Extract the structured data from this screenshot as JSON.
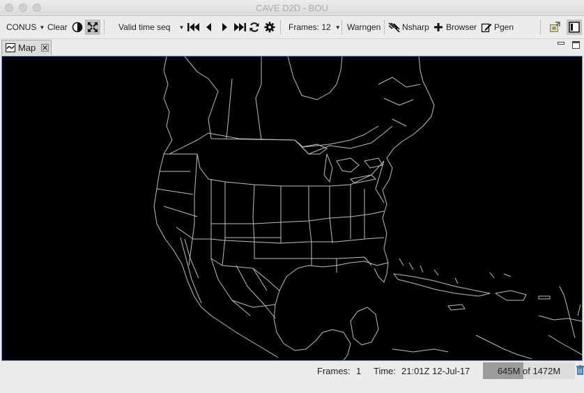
{
  "window": {
    "title": "CAVE D2D - BOU"
  },
  "toolbar": {
    "scale": "CONUS",
    "clear": "Clear",
    "time_mode": "Valid time seq",
    "frames": "Frames: 12",
    "warngen": "Warngen",
    "nsharp": "Nsharp",
    "browser": "Browser",
    "pgen": "Pgen"
  },
  "tabs": [
    {
      "label": "Map"
    }
  ],
  "status": {
    "frames_label": "Frames:",
    "frames_value": "1",
    "time_label": "Time:",
    "time_value": "21:01Z 12-Jul-17",
    "memory_used": "645M",
    "memory_of": "of",
    "memory_total": "1472M",
    "memory_fraction": 0.44
  },
  "colors": {
    "map_background": "#000000",
    "map_lines": "#bdbdbd",
    "memory_bar": "#9c9c9c"
  },
  "icons": [
    "contrast-icon",
    "zoom-fit-icon",
    "first-frame-icon",
    "prev-frame-icon",
    "next-frame-icon",
    "last-frame-icon",
    "loop-icon",
    "settings-icon",
    "nsharp-icon",
    "plus-icon",
    "edit-icon",
    "perspective-icon",
    "view-icon",
    "minimize-icon",
    "maximize-icon",
    "trash-icon"
  ]
}
